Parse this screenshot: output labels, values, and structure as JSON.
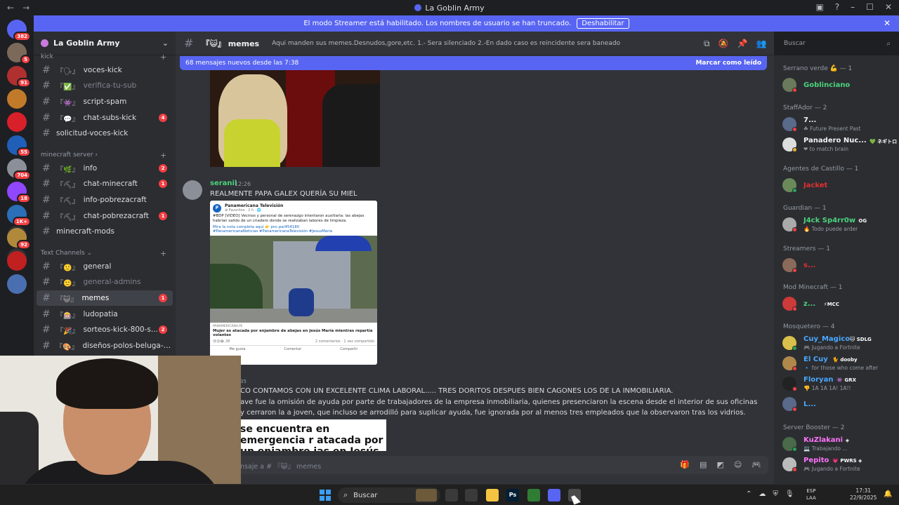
{
  "window": {
    "title": "La Goblin Army",
    "nav_back": "←",
    "nav_forward": "→"
  },
  "servers": [
    {
      "badge": "382",
      "color": "#5865f2"
    },
    {
      "badge": "5",
      "color": "#7b6a5a"
    },
    {
      "badge": "91",
      "color": "#b03030"
    },
    {
      "badge": "",
      "color": "#c07a2a"
    },
    {
      "badge": "",
      "color": "#d8202a"
    },
    {
      "badge": "55",
      "color": "#1f5fb8"
    },
    {
      "badge": "704",
      "color": "#8a8f98"
    },
    {
      "badge": "18",
      "color": "#9146ff"
    },
    {
      "badge": "1K+",
      "color": "#2a6fb8"
    },
    {
      "badge": "92",
      "color": "#b08a3a"
    },
    {
      "badge": "",
      "color": "#c02020"
    },
    {
      "badge": "",
      "color": "#4a6fb0"
    }
  ],
  "server_actions": {
    "add": "+",
    "explore": "⊘"
  },
  "banner": {
    "text": "El modo Streamer está habilitado. Los nombres de usuario se han truncado.",
    "button": "Deshabilitar",
    "close": "✕"
  },
  "guild": {
    "name": "La Goblin Army",
    "chevron": "⌄"
  },
  "categories": {
    "kick": "kick",
    "minecraft": "minecraft server",
    "text": "Text Channels",
    "add": "+",
    "chev": "›",
    "down": "⌄"
  },
  "channels": [
    {
      "deco": "『🗣』",
      "name": "voces-kick",
      "badge": "",
      "muted": false
    },
    {
      "deco": "『✅』",
      "name": "verifica-tu-sub",
      "badge": "",
      "muted": true
    },
    {
      "deco": "『👾』",
      "name": "script-spam",
      "badge": "",
      "muted": false
    },
    {
      "deco": "『💬』",
      "name": "chat-subs-kick",
      "badge": "4",
      "muted": false
    },
    {
      "deco": "",
      "name": "solicitud-voces-kick",
      "badge": "",
      "muted": false
    },
    {
      "deco": "『🌿』",
      "name": "info",
      "badge": "2",
      "muted": false
    },
    {
      "deco": "『⛏』",
      "name": "chat-minecraft",
      "badge": "1",
      "muted": false
    },
    {
      "deco": "『⛏』",
      "name": "info-pobrezacraft",
      "badge": "",
      "muted": false
    },
    {
      "deco": "『⛏』",
      "name": "chat-pobrezacraft",
      "badge": "1",
      "muted": false
    },
    {
      "deco": "",
      "name": "minecraft-mods",
      "badge": "",
      "muted": false
    },
    {
      "deco": "『🙂』",
      "name": "general",
      "badge": "",
      "muted": false
    },
    {
      "deco": "『🙂』",
      "name": "general-admins",
      "badge": "",
      "muted": true
    },
    {
      "deco": "『😺』",
      "name": "memes",
      "badge": "1",
      "muted": false,
      "selected": true
    },
    {
      "deco": "『🎰』",
      "name": "ludopatia",
      "badge": "",
      "muted": false
    },
    {
      "deco": "『🎉』",
      "name": "sorteos-kick-800-s...",
      "badge": "2",
      "muted": false
    },
    {
      "deco": "『🎨』",
      "name": "diseños-polos-beluga-ar...",
      "badge": "",
      "muted": false
    }
  ],
  "header": {
    "hash": "#",
    "channel": "『😺』 memes",
    "topic": "Aqui manden sus memes.Desnudos,gore,etc. 1.- Sera silenciado 2.-En dado caso es reincidente sera baneado",
    "search_placeholder": "Buscar",
    "tools": [
      "threads-icon",
      "mute-icon",
      "pin-icon",
      "members-icon"
    ]
  },
  "new_messages": {
    "text": "68 mensajes nuevos desde las 7:38",
    "mark_read": "Marcar como leído"
  },
  "message1": {
    "author": "seranil",
    "time": "12:26",
    "text": "REALMENTE PAPA GALEX QUERÍA SU MIEL",
    "card": {
      "page": "Panamericana Televisión",
      "meta": "⊕ Favoritos · 2 h · 🌐",
      "post": "#BDP [VIDEO] Vecinos y personal de serenazgo intentaron auxiliarla: las abejas habrían salido de un criadero donde se realizaban labores de limpieza.",
      "more": "Mira la nota completa aquí 👉 pnc.pe/454180",
      "tags": "#PanamericanaNoticias #PanamericanaTelevisión #JesusMaría",
      "source": "PANAMERICANA.PE",
      "headline": "Mujer es atacada por enjambre de abejas en Jesús María mientras repartía volantes",
      "reactions": "😢😮😂 28",
      "comments": "2 comentarios · 1 vez compartido",
      "actions": [
        "Me gusta",
        "Comentar",
        "Compartir"
      ]
    }
  },
  "message2": {
    "time": "35",
    "line1": "CO CONTAMOS CON UN EXCELENTE CLIMA LABORAL..... TRES DORITOS DESPUES BIEN CAGONES LOS DE LA INMOBILIARIA.",
    "body": "ave fue la omisión de ayuda por parte de trabajadores de la empresa inmobiliaria, quienes presenciaron la escena desde el interior de sus oficinas y cerraron la a joven, que incluso se arrodilló para suplicar ayuda, fue ignorada por al menos tres empleados que la observaron tras los vidrios.",
    "image_text": "se encuentra en emergencia r atacada por un enjambre ias en Jesús María"
  },
  "composer": {
    "placeholder": "nsaje a # 『😺』 memes"
  },
  "members": {
    "groups": [
      {
        "label": "Serrano verde 💪 — 1"
      },
      {
        "label": "StaffAdor — 2"
      },
      {
        "label": "Agentes de Castillo — 1"
      },
      {
        "label": "Guardian — 1"
      },
      {
        "label": "Streamers — 1"
      },
      {
        "label": "Mod Minecraft — 1"
      },
      {
        "label": "Mosquetero — 4"
      },
      {
        "label": "Server Booster — 2"
      }
    ],
    "list": [
      {
        "name": "Goblinciano",
        "color": "#4cd37c",
        "tag": "",
        "activity": "",
        "status": "#f23f43"
      },
      {
        "name": "7...",
        "color": "#f2f3f5",
        "tag": "",
        "activity": "☘ Future Present Past",
        "status": "#f23f43"
      },
      {
        "name": "Panadero Nuc...",
        "color": "#f2f3f5",
        "tag": "💚 ネギトロ",
        "activity": "❤ to match brain",
        "status": "#f0b232"
      },
      {
        "name": "Jacket",
        "color": "#e03030",
        "tag": "",
        "activity": "",
        "status": "#23a55a"
      },
      {
        "name": "J4ck Sp4rr0w",
        "color": "#4cd37c",
        "tag": "OG",
        "activity": "🔥 Todo puede arder",
        "status": "#f23f43"
      },
      {
        "name": "s...",
        "color": "#e03030",
        "tag": "",
        "activity": "",
        "status": "#f23f43"
      },
      {
        "name": "z...",
        "color": "#4cd37c",
        "tag": "⚡MCC",
        "activity": "",
        "status": "#f23f43"
      },
      {
        "name": "Cuy_Magico",
        "color": "#4aa8ff",
        "tag": "🐱 SDLG",
        "activity": "🎮 Jugando a Fortnite",
        "status": "#23a55a"
      },
      {
        "name": "El Cuy",
        "color": "#4aa8ff",
        "tag": "🐈 dooby",
        "activity": "🔹 for those who come after",
        "status": "#f23f43"
      },
      {
        "name": "Floryan",
        "color": "#4aa8ff",
        "tag": "👾 GRX",
        "activity": "👎 1A 1A 1A! 1A!!",
        "status": "#f23f43"
      },
      {
        "name": "L...",
        "color": "#4aa8ff",
        "tag": "",
        "activity": "",
        "status": "#f23f43"
      },
      {
        "name": "KuZlakani",
        "color": "#ff73fa",
        "tag": "◈",
        "activity": "💻 Trabajando ...",
        "status": "#23a55a"
      },
      {
        "name": "Pepito",
        "color": "#ff73fa",
        "tag": "💗 PWRS ◈",
        "activity": "🎮 Jugando a Fortnite",
        "status": "#f23f43"
      }
    ]
  },
  "taskbar": {
    "search": "Buscar",
    "apps": [
      {
        "label": "",
        "color": "#3a3a3a"
      },
      {
        "label": "",
        "color": "#3a3a3a"
      },
      {
        "label": "",
        "color": "#f5c542"
      },
      {
        "label": "Ps",
        "color": "#001e36"
      },
      {
        "label": "",
        "color": "#2e7d32"
      },
      {
        "label": "",
        "color": "#5865f2"
      },
      {
        "label": "",
        "color": "#4a4a4a"
      }
    ],
    "lang": "ESP\nLAA",
    "time": "17:31",
    "date": "22/9/2025"
  }
}
